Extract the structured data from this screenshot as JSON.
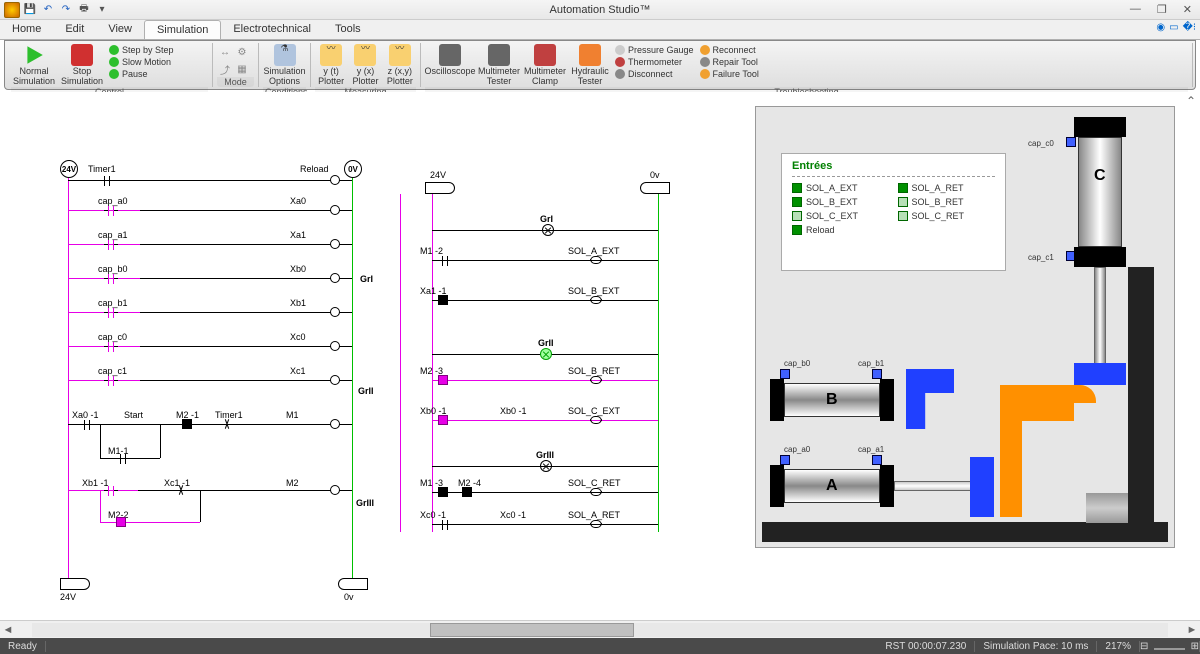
{
  "app": {
    "title": "Automation Studio™"
  },
  "window_controls": {
    "min": "—",
    "max": "❐",
    "close": "✕"
  },
  "qat_icons": [
    "app",
    "save",
    "undo",
    "redo",
    "print",
    "copy"
  ],
  "toolbar_right": [
    "help",
    "min-ribbon",
    "opts"
  ],
  "ribbon_tabs": [
    "Home",
    "Edit",
    "View",
    "Simulation",
    "Electrotechnical",
    "Tools"
  ],
  "active_tab": "Simulation",
  "ribbon": {
    "groups": [
      {
        "label": "Control",
        "large": [
          {
            "name": "normal-sim",
            "label": "Normal Simulation",
            "color": "#2dbf2d"
          },
          {
            "name": "stop-sim",
            "label": "Stop Simulation",
            "color": "#d03030"
          }
        ],
        "small": [
          {
            "name": "step",
            "label": "Step by Step",
            "icon": "▶",
            "color": "#2dbf2d"
          },
          {
            "name": "slow",
            "label": "Slow Motion",
            "icon": "◐",
            "color": "#2dbf2d"
          },
          {
            "name": "pause",
            "label": "Pause",
            "icon": "⏸",
            "color": "#2dbf2d"
          }
        ]
      },
      {
        "label": "Mode",
        "large": [],
        "small_icons": [
          "↔",
          "⚙",
          "⤴",
          "▦"
        ]
      },
      {
        "label": "Conditions",
        "large": [
          {
            "name": "sim-options",
            "label": "Simulation Options",
            "color": "#b0c4de"
          }
        ]
      },
      {
        "label": "Measuring",
        "large": [
          {
            "name": "yt-plotter",
            "label": "y (t) Plotter",
            "color": "#f0c040"
          },
          {
            "name": "yx-plotter",
            "label": "y (x) Plotter",
            "color": "#f0c040"
          },
          {
            "name": "zxy-plotter",
            "label": "z (x,y) Plotter",
            "color": "#f0c040"
          }
        ]
      },
      {
        "label": "Troubleshooting",
        "large": [
          {
            "name": "oscilloscope",
            "label": "Oscilloscope",
            "color": "#888"
          },
          {
            "name": "multimeter",
            "label": "Multimeter Tester",
            "color": "#888"
          },
          {
            "name": "clamp",
            "label": "Multimeter Clamp",
            "color": "#888"
          },
          {
            "name": "hyd-tester",
            "label": "Hydraulic Tester",
            "color": "#f08030"
          }
        ],
        "small": [
          {
            "name": "pressure",
            "label": "Pressure Gauge",
            "icon": "◔",
            "color": "#888"
          },
          {
            "name": "thermo",
            "label": "Thermometer",
            "icon": "🌡",
            "color": "#c04040"
          },
          {
            "name": "disconnect",
            "label": "Disconnect",
            "icon": "⛓",
            "color": "#888"
          },
          {
            "name": "reconnect",
            "label": "Reconnect",
            "icon": "🔗",
            "color": "#f0a030"
          },
          {
            "name": "repair",
            "label": "Repair Tool",
            "icon": "🔧",
            "color": "#888"
          },
          {
            "name": "failure",
            "label": "Failure Tool",
            "icon": "⚡",
            "color": "#f0a030"
          }
        ]
      }
    ]
  },
  "circuit": {
    "rails": {
      "left_v": "24V",
      "right_v": "0V"
    },
    "timer_label": "Timer1",
    "reload_label": "Reload",
    "bus_left": "24V",
    "bus_right": "0v",
    "ladder_rows": [
      {
        "left": "cap_a0",
        "right": "Xa0"
      },
      {
        "left": "cap_a1",
        "right": "Xa1"
      },
      {
        "left": "cap_b0",
        "right": "Xb0"
      },
      {
        "left": "cap_b1",
        "right": "Xb1"
      },
      {
        "left": "cap_c0",
        "right": "Xc0"
      },
      {
        "left": "cap_c1",
        "right": "Xc1"
      }
    ],
    "logic_row1": {
      "a": "Xa0 -1",
      "b": "Start",
      "c": "M2 -1",
      "d": "Timer1",
      "out": "M1"
    },
    "logic_row1b": "M1-1",
    "logic_row2": {
      "a": "Xb1 -1",
      "b": "Xc1 -1",
      "out": "M2"
    },
    "logic_row2b": "M2-2",
    "grafcet_rail_left": "24V",
    "grafcet_rail_right": "0v",
    "gr_steps": [
      "GrI",
      "GrII",
      "GrIII"
    ],
    "gr_lamps": [
      "GrI",
      "GrII",
      "GrIII"
    ],
    "gr_rows": [
      {
        "c": "M1 -2",
        "sol": "SOL_A_EXT"
      },
      {
        "c": "Xa1 -1",
        "sol": "SOL_B_EXT"
      },
      {
        "c": "M2 -3",
        "sol": "SOL_B_RET"
      },
      {
        "c": "Xb0 -1",
        "sol": "SOL_C_EXT"
      },
      {
        "c": "M1 -3",
        "c2": "M2 -4",
        "sol": "SOL_C_RET"
      },
      {
        "c": "Xc0 -1",
        "sol": "SOL_A_RET"
      }
    ]
  },
  "entrees": {
    "title": "Entrées",
    "items": [
      {
        "label": "SOL_A_EXT",
        "color": "#009000"
      },
      {
        "label": "SOL_A_RET",
        "color": "#009000"
      },
      {
        "label": "SOL_B_EXT",
        "color": "#009000"
      },
      {
        "label": "SOL_B_RET",
        "color": "#b8e0b8"
      },
      {
        "label": "SOL_C_EXT",
        "color": "#b8e0b8"
      },
      {
        "label": "SOL_C_RET",
        "color": "#b8e0b8"
      },
      {
        "label": "Reload",
        "color": "#009000"
      }
    ]
  },
  "machine": {
    "sensors": [
      "cap_c0",
      "cap_c1",
      "cap_b0",
      "cap_b1",
      "cap_a0",
      "cap_a1"
    ],
    "cylinders": [
      "A",
      "B",
      "C"
    ]
  },
  "status": {
    "ready": "Ready",
    "sim_time": "RST 00:00:07.230",
    "pace": "Simulation Pace: 10 ms",
    "zoom": "217%"
  }
}
